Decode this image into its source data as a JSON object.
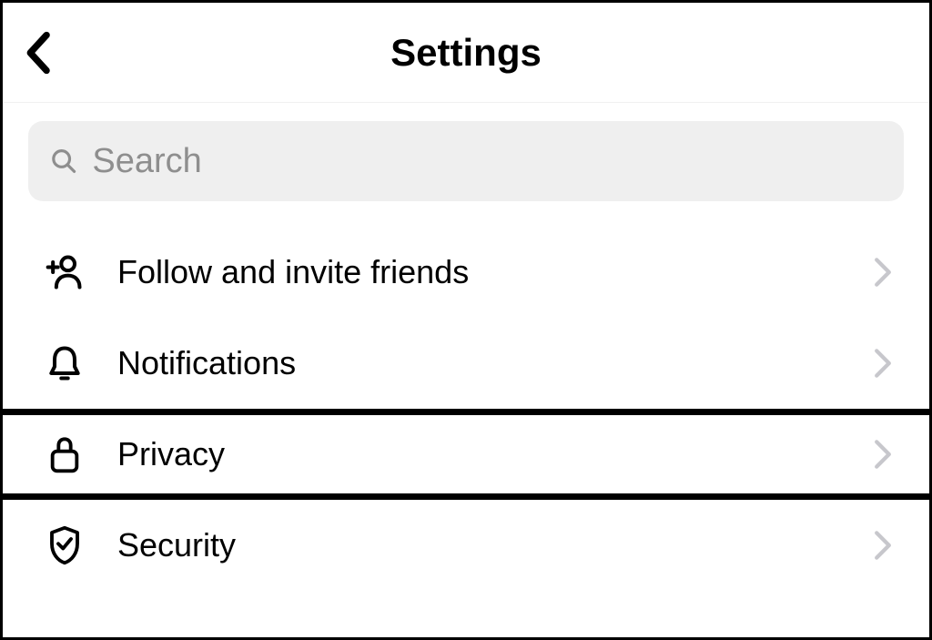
{
  "header": {
    "title": "Settings"
  },
  "search": {
    "placeholder": "Search"
  },
  "items": [
    {
      "icon": "add-friend-icon",
      "label": "Follow and invite friends",
      "highlighted": false
    },
    {
      "icon": "bell-icon",
      "label": "Notifications",
      "highlighted": false
    },
    {
      "icon": "lock-icon",
      "label": "Privacy",
      "highlighted": true
    },
    {
      "icon": "shield-check-icon",
      "label": "Security",
      "highlighted": false
    }
  ]
}
